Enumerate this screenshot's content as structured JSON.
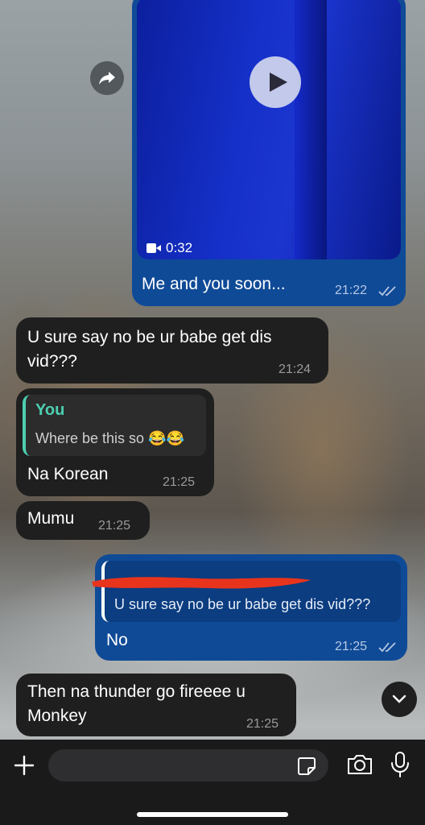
{
  "messages": {
    "video": {
      "duration": "0:32",
      "caption": "Me and you soon...",
      "time": "21:22"
    },
    "msg2": {
      "text": "U sure say no be ur babe get dis vid???",
      "time": "21:24"
    },
    "msg3": {
      "quote_name": "You",
      "quote_text": "Where be this so 😂😂",
      "text": "Na Korean",
      "time": "21:25"
    },
    "msg4": {
      "text": "Mumu",
      "time": "21:25"
    },
    "msg5": {
      "quote_text": "U sure say no be ur babe get dis vid???",
      "text": "No",
      "time": "21:25"
    },
    "msg6": {
      "text": "Then na thunder go fireeee u Monkey",
      "time": "21:25"
    }
  },
  "composer": {
    "placeholder": ""
  },
  "colors": {
    "incoming_bubble": "#1f1f1f",
    "outgoing_bubble": "#0f4a97",
    "quote_accent": "#4ccfb0",
    "redaction": "#e8341c"
  }
}
